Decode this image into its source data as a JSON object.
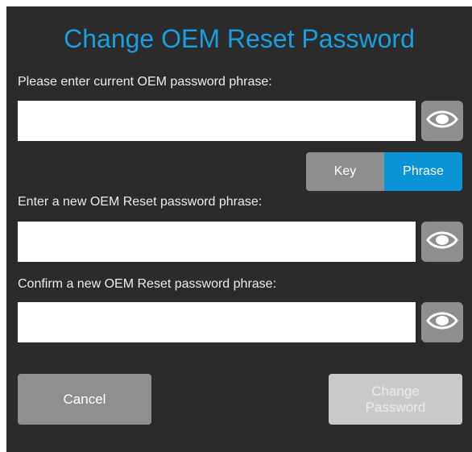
{
  "dialog": {
    "title": "Change OEM Reset Password"
  },
  "current_password": {
    "label": "Please enter current OEM password phrase:",
    "value": ""
  },
  "mode_toggle": {
    "key_label": "Key",
    "phrase_label": "Phrase",
    "selected": "Phrase"
  },
  "new_password": {
    "label": "Enter a new OEM Reset password phrase:",
    "value": ""
  },
  "confirm_password": {
    "label": "Confirm a new OEM Reset password phrase:",
    "value": ""
  },
  "buttons": {
    "cancel_label": "Cancel",
    "change_label_line1": "Change",
    "change_label_line2": "Password"
  },
  "icons": {
    "reveal": "eye-icon"
  },
  "colors": {
    "background": "#2b2b2b",
    "title": "#1a9ee0",
    "accent": "#0a93d6",
    "button_gray": "#8e8e8e",
    "disabled": "#c9c9c9"
  }
}
